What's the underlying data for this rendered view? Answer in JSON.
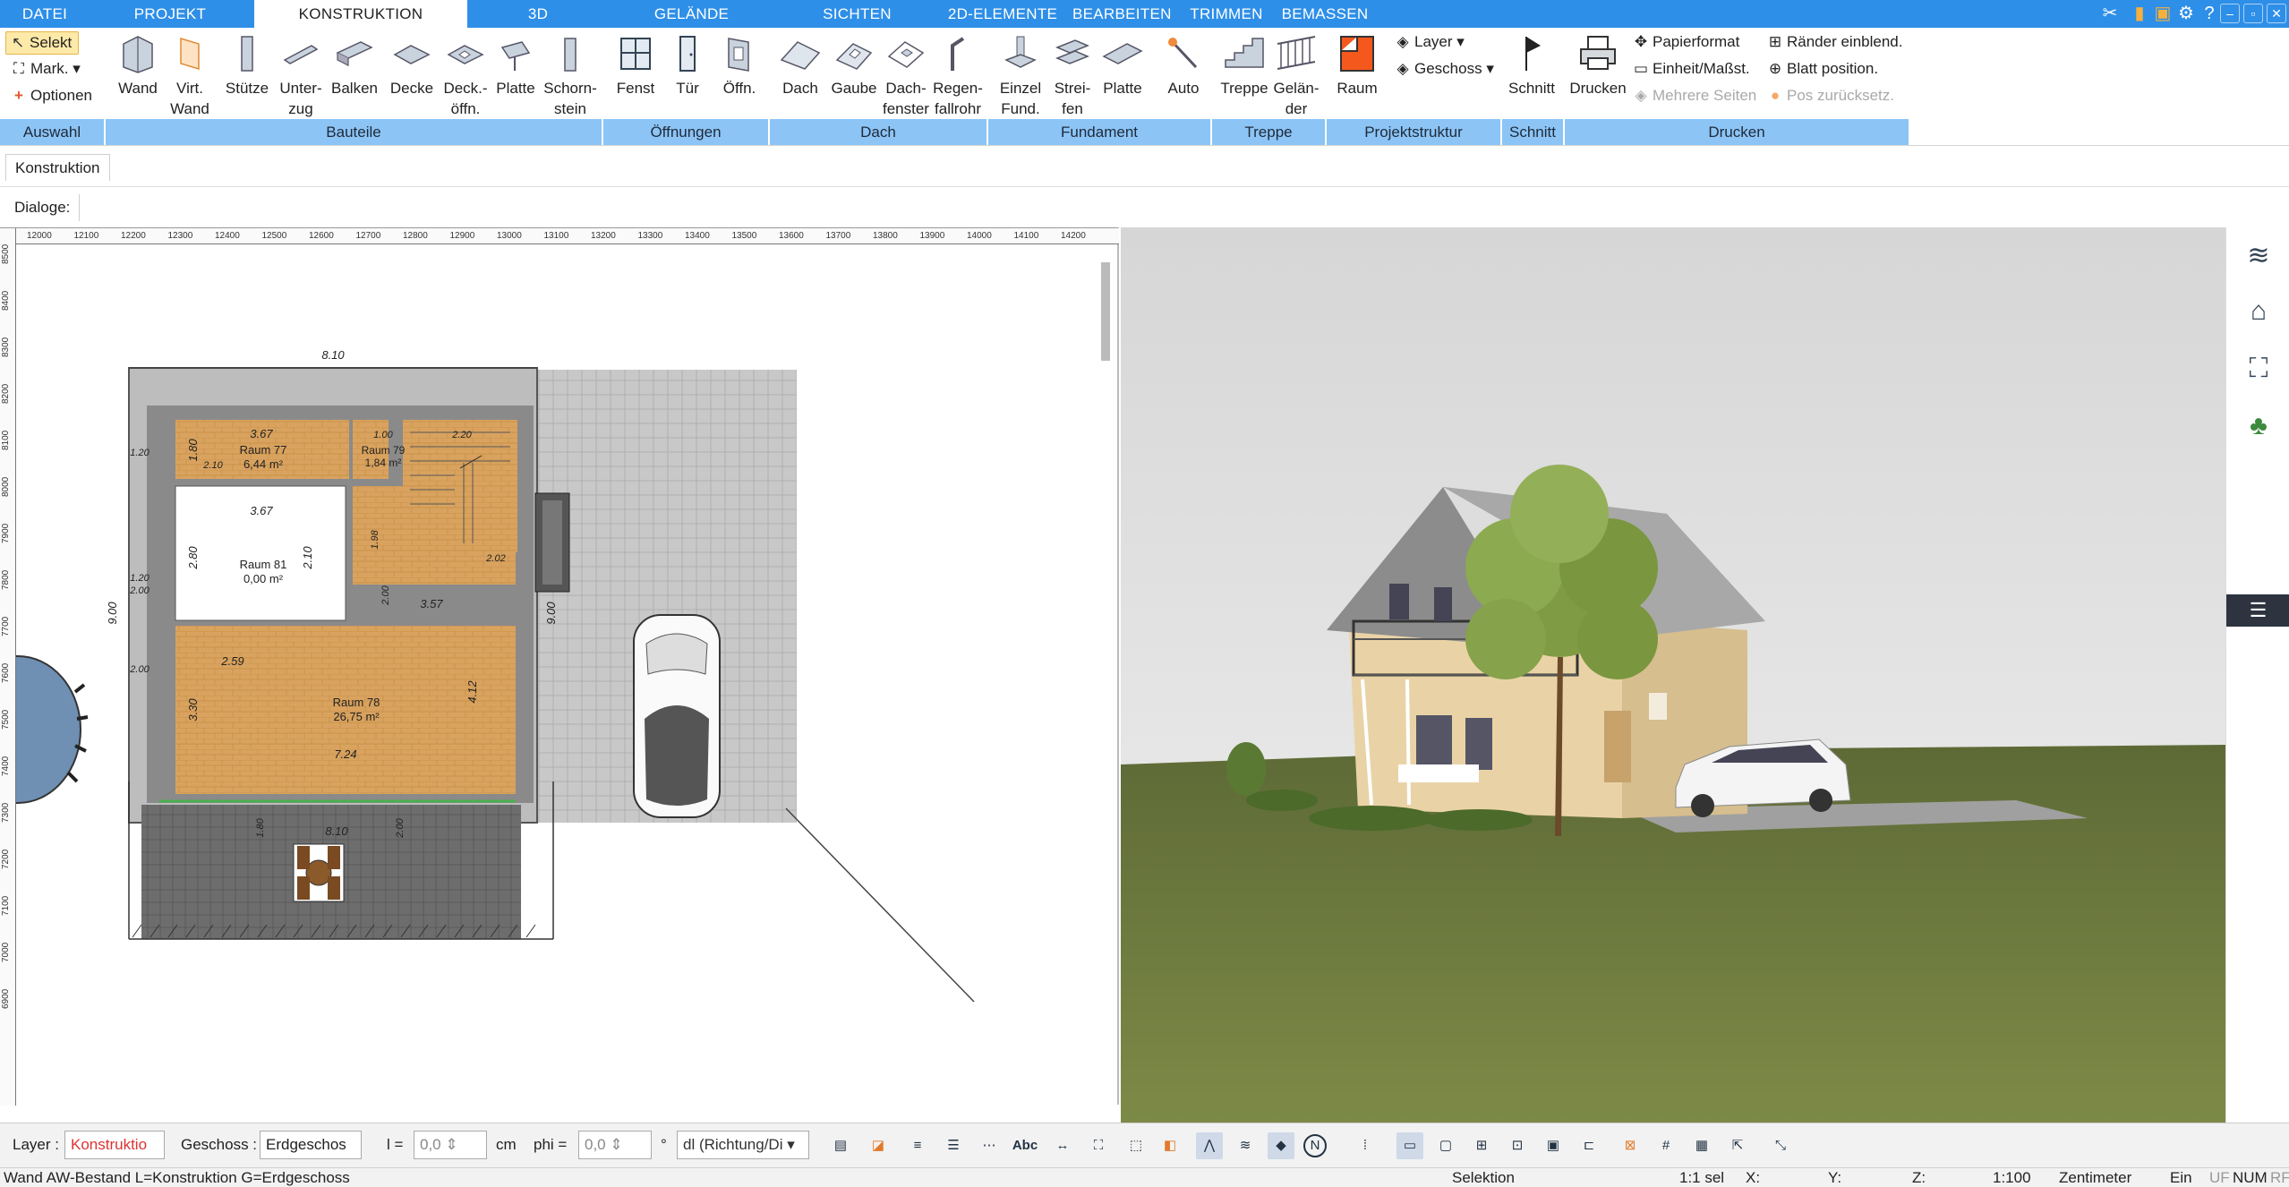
{
  "menu": {
    "tabs": [
      "DATEI",
      "PROJEKT",
      "KONSTRUKTION",
      "3D",
      "GELÄNDE",
      "SICHTEN",
      "2D-ELEMENTE",
      "BEARBEITEN",
      "TRIMMEN",
      "BEMASSEN"
    ],
    "active": "KONSTRUKTION"
  },
  "ribbon": {
    "auswahl": {
      "select": "Selekt",
      "mark": "Mark.",
      "options": "Optionen"
    },
    "bauteile": [
      "Wand",
      "Virt.\nWand",
      "Stütze",
      "Unter-\nzug",
      "Balken",
      "Decke",
      "Deck.-\nöffn.",
      "Platte",
      "Schorn-\nstein"
    ],
    "oeffnungen": [
      "Fenst",
      "Tür",
      "Öffn."
    ],
    "dach": [
      "Dach",
      "Gaube",
      "Dach-\nfenster",
      "Regen-\nfallrohr"
    ],
    "fundament": [
      "Einzel\nFund.",
      "Strei-\nfen",
      "Platte"
    ],
    "auto": "Auto",
    "treppe": [
      "Treppe",
      "Gelän-\nder"
    ],
    "raum": "Raum",
    "projektstruktur": {
      "layer": "Layer",
      "geschoss": "Geschoss"
    },
    "schnitt": "Schnitt",
    "drucken": "Drucken",
    "print_options": {
      "papierformat": "Papierformat",
      "einheit": "Einheit/Maßst.",
      "mehrere": "Mehrere Seiten",
      "raender": "Ränder einblend.",
      "blatt": "Blatt position.",
      "pos": "Pos zurücksetz."
    },
    "groups": [
      "Auswahl",
      "Bauteile",
      "Öffnungen",
      "Dach",
      "Fundament",
      "Treppe",
      "Projektstruktur",
      "Schnitt",
      "Drucken"
    ]
  },
  "tabs_row": {
    "tab": "Konstruktion",
    "dialoge": "Dialoge:"
  },
  "ruler": {
    "top": [
      "12000",
      "12100",
      "12200",
      "12300",
      "12400",
      "12500",
      "12600",
      "12700",
      "12800",
      "12900",
      "13000",
      "13100",
      "13200",
      "13300",
      "13400",
      "13500",
      "13600",
      "13700",
      "13800",
      "13900",
      "14000",
      "14100",
      "14200"
    ],
    "left": [
      "8500",
      "8400",
      "8300",
      "8200",
      "8100",
      "8000",
      "7900",
      "7800",
      "7700",
      "7600",
      "7500",
      "7400",
      "7300",
      "7200",
      "7100",
      "7000",
      "6900"
    ]
  },
  "plan": {
    "dims": {
      "top": "8.10",
      "left": "9.00",
      "bottom": "8.10",
      "right": "9.00",
      "w1": "3.67",
      "w2": "3.67",
      "w3": "2.59",
      "w4": "3.57",
      "w5": "7.24",
      "h1": "1.80",
      "h2": "2.80",
      "h3": "3.30",
      "h4": "4.12",
      "h5": "2.10",
      "s1": "1.00",
      "s2": "2.20",
      "s3": "1.98",
      "s4": "2.02",
      "s5": "2.10",
      "s6": "2.00",
      "s7": "1.20",
      "s8": "2.00",
      "s9": "2.00",
      "s10": "1.20",
      "s11": "1.80",
      "s12": "2.00"
    },
    "rooms": [
      {
        "name": "Raum 77",
        "area": "6,44 m²"
      },
      {
        "name": "Raum 79",
        "area": "1,84 m²"
      },
      {
        "name": "Raum 81",
        "area": "0,00 m²"
      },
      {
        "name": "Raum 78",
        "area": "26,75 m²"
      }
    ]
  },
  "bottom_toolbar": {
    "layer_label": "Layer :",
    "layer_value": "Konstruktio",
    "geschoss_label": "Geschoss :",
    "geschoss_value": "Erdgeschos",
    "l_label": "l =",
    "l_value": "0,0",
    "unit": "cm",
    "phi_label": "phi =",
    "phi_value": "0,0",
    "deg": "°",
    "dl_value": "dl (Richtung/Di"
  },
  "status": {
    "left": "Wand AW-Bestand L=Konstruktion G=Erdgeschoss",
    "mode": "Selektion",
    "sel": "1:1 sel",
    "x": "X:",
    "y": "Y:",
    "z": "Z:",
    "scale": "1:100",
    "unit": "Zentimeter",
    "ein": "Ein",
    "uf": "UF",
    "num": "NUM",
    "rf": "RF"
  },
  "colors": {
    "accent": "#2e8fe8",
    "group_bar": "#8cc4f5",
    "floor": "#d9a35f",
    "paving": "#bfbfbf",
    "grass": "#6f7f3a",
    "sky": "#dcdcdc"
  }
}
